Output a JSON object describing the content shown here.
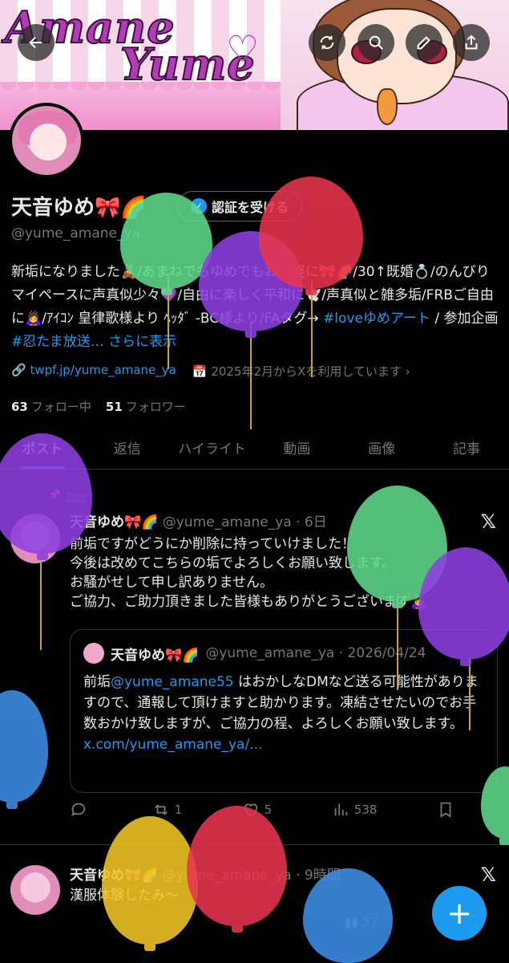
{
  "banner": {
    "title_line1": "Amane",
    "title_line2": "Yume"
  },
  "header_buttons": [
    "back-arrow",
    "refresh",
    "search",
    "edit",
    "share"
  ],
  "profile": {
    "name": "天音ゆめ🎀🌈",
    "handle": "@yume_amane_ya",
    "verify_label": "認証を受ける",
    "bio_text": "新垢になりました🧸/あまねでもゆめでもお気軽に🎀🌈/30↑既婚💍/のんびりマイペースに声真似少々💜/自由に楽しく平和に🕊️/声真似と雑多垢/FRBご自由に🙇‍♀️/ｱｲｺﾝ 皇律歌様より ﾍｯﾀﾞ -BC様より/FAタグ→",
    "bio_tag1": "#loveゆめアート",
    "bio_mid": "/ 参加企画",
    "bio_tag2": "#忍たま放送…",
    "bio_more": "さらに表示",
    "link": "twpf.jp/yume_amane_ya",
    "joined": "2025年2月からXを利用しています",
    "following_count": "63",
    "following_label": "フォロー中",
    "followers_count": "51",
    "followers_label": "フォロワー"
  },
  "tabs": [
    "ポスト",
    "返信",
    "ハイライト",
    "動画",
    "画像",
    "記事"
  ],
  "pinned_label": "固定",
  "post1": {
    "name": "天音ゆめ🎀🌈",
    "handle_time": "@yume_amane_ya · 6日",
    "line1": "前垢ですがどうにか削除に持っていけました！",
    "line2": "今後は改めてこちらの垢でよろしくお願い致します。",
    "line3": "お騒がせして申し訳ありません。",
    "line4": "ご協力、ご助力頂きました皆様もありがとうございます🙇‍♀️",
    "quote": {
      "name": "天音ゆめ🎀🌈",
      "handle_time": "@yume_amane_ya · 2026/04/24",
      "pre": "前垢",
      "mention": "@yume_amane55",
      "post": " はおかしなDMなど送る可能性がありますので、通報して頂けますと助かります。凍結させたいのでお手数おかけ致しますが、ご協力の程、よろしくお願い致します。",
      "link": "x.com/yume_amane_ya/..."
    },
    "replies": "",
    "reposts": "1",
    "likes": "5",
    "views": "538"
  },
  "post2": {
    "name": "天音ゆめ🎀🌈",
    "handle_time": "@yume_amane_ya · 9時間",
    "text": "漢服体験したみ〜",
    "views": "57"
  },
  "colors": {
    "accent": "#1d9bf0",
    "bg": "#000000",
    "muted": "#71767b"
  }
}
